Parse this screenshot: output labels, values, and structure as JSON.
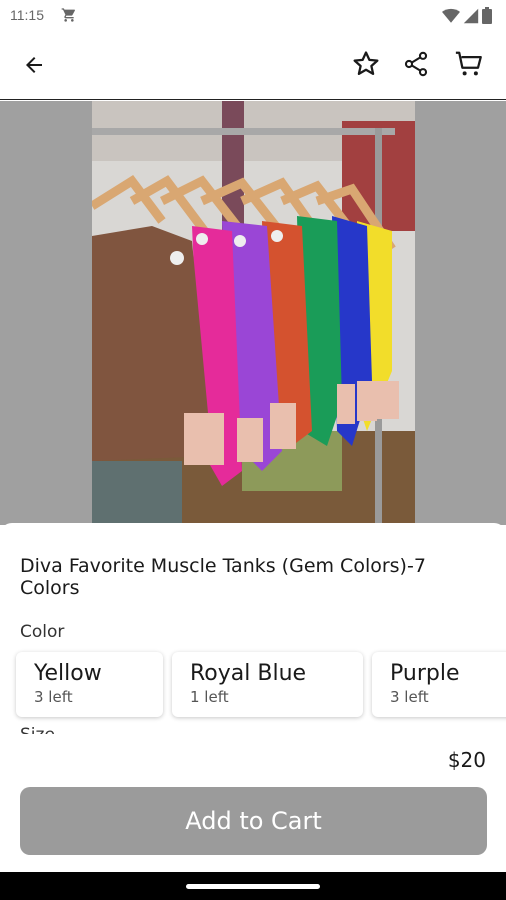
{
  "status_bar": {
    "time": "11:15",
    "icons": [
      "shopping-cart-icon",
      "wifi-icon",
      "signal-icon",
      "battery-icon"
    ]
  },
  "app_bar": {
    "icons": [
      "back-arrow-icon",
      "star-icon",
      "share-icon",
      "cart-icon"
    ]
  },
  "product": {
    "title": "Diva Favorite Muscle Tanks (Gem Colors)-7 Colors",
    "color_label": "Color",
    "variants": [
      {
        "name": "Yellow",
        "stock": "3 left"
      },
      {
        "name": "Royal Blue",
        "stock": "1 left"
      },
      {
        "name": "Purple",
        "stock": "3 left"
      }
    ],
    "size_label": "Size",
    "price": "$20",
    "add_to_cart_label": "Add to Cart"
  },
  "colors": {
    "button_disabled": "#9b9b9b",
    "image_backdrop": "#a0a0a0"
  }
}
